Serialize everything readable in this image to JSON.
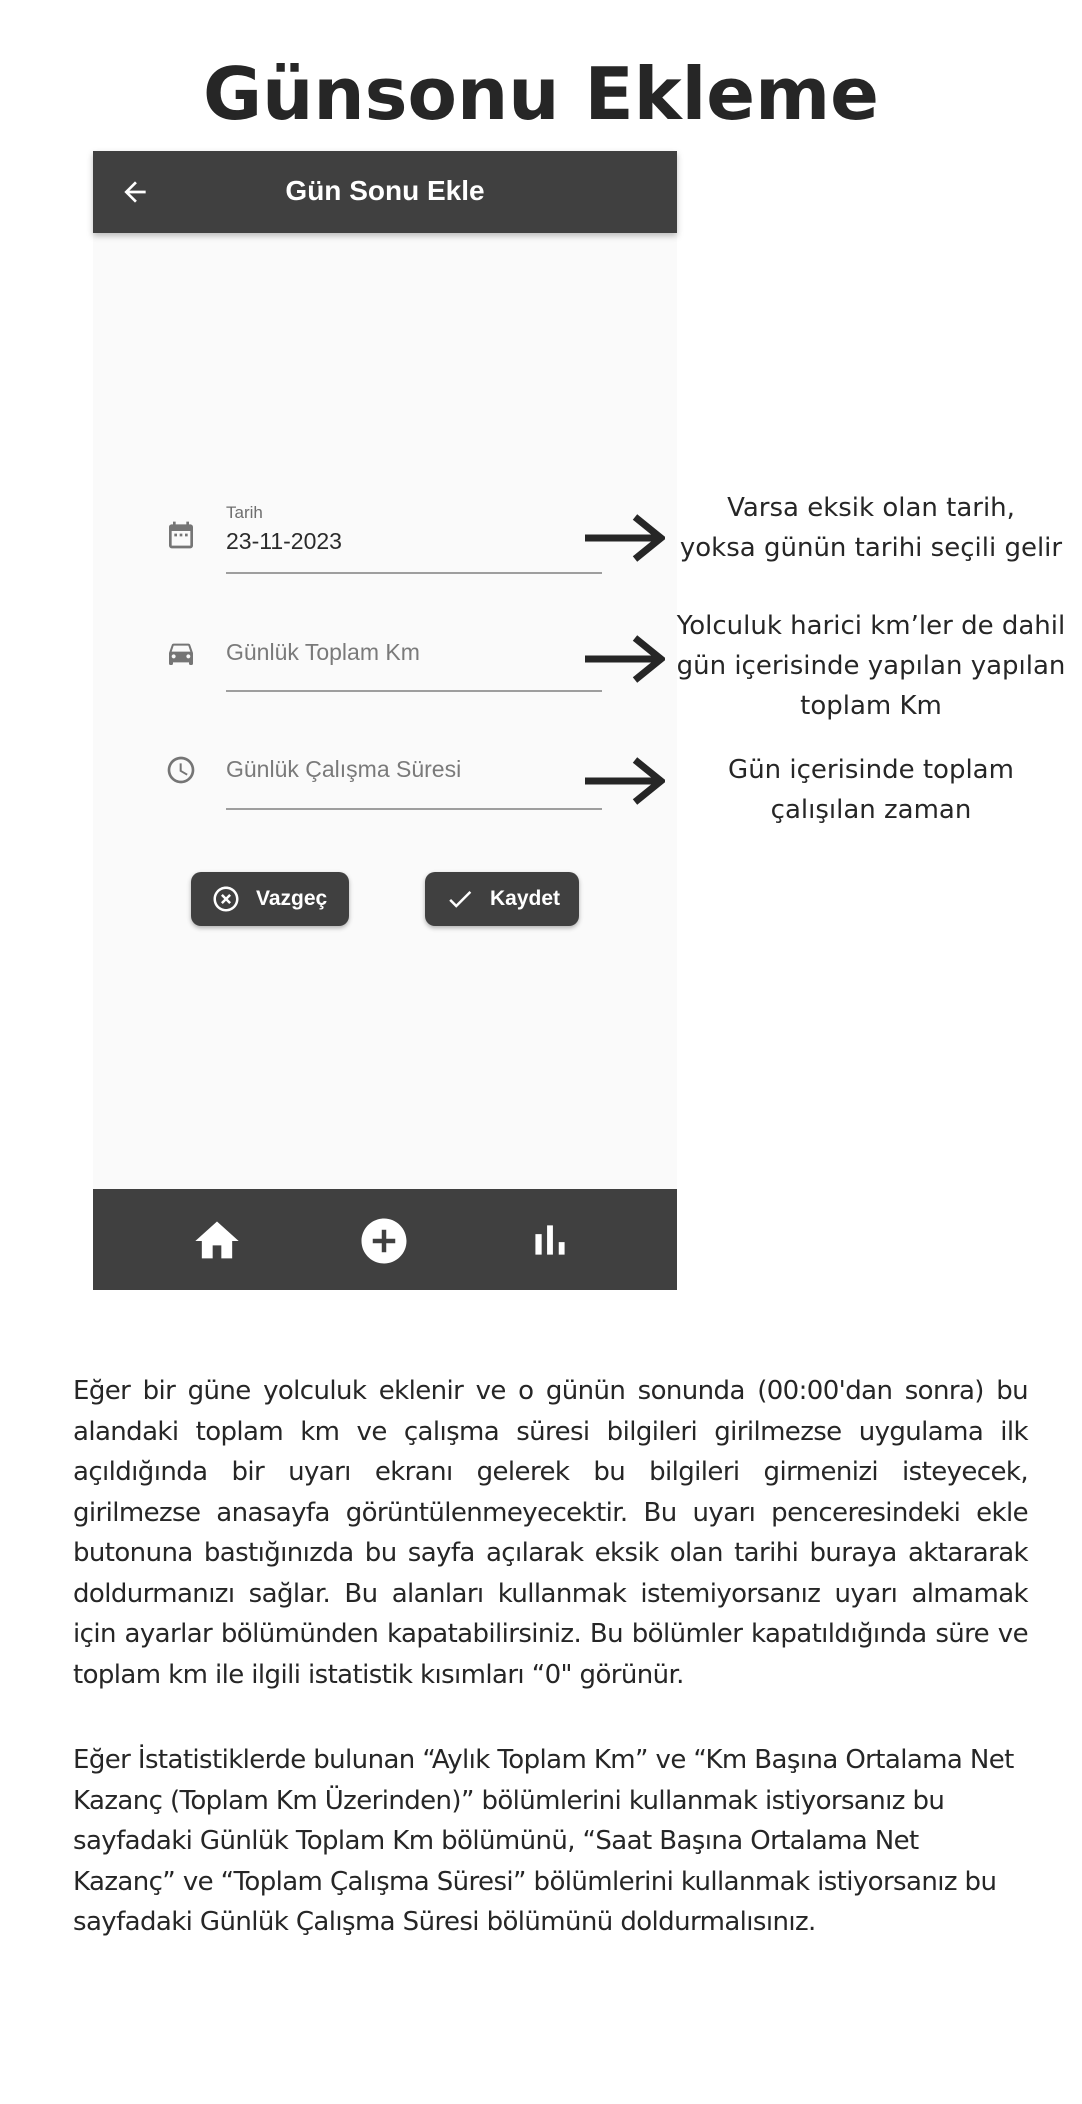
{
  "page": {
    "title": "Günsonu Ekleme"
  },
  "app": {
    "title": "Gün Sonu Ekle",
    "fields": {
      "date": {
        "label": "Tarih",
        "value": "23-11-2023",
        "icon": "calendar-icon"
      },
      "km": {
        "placeholder": "Günlük Toplam Km",
        "icon": "car-icon"
      },
      "duration": {
        "placeholder": "Günlük Çalışma Süresi",
        "icon": "clock-icon"
      }
    },
    "buttons": {
      "cancel": {
        "label": "Vazgeç",
        "icon": "cancel-circle-icon"
      },
      "save": {
        "label": "Kaydet",
        "icon": "check-icon"
      }
    },
    "nav": [
      "home-icon",
      "add-circle-icon",
      "bar-chart-icon"
    ],
    "colors": {
      "bar": "#404040",
      "background": "#fafafa"
    }
  },
  "annotations": {
    "date": "Varsa eksik olan tarih,\nyoksa günün tarihi seçili gelir",
    "km": "Yolculuk harici km’ler de dahil\ngün içerisinde yapılan yapılan\ntoplam Km",
    "duration": "Gün içerisinde toplam\nçalışılan zaman"
  },
  "paragraphs": [
    "Eğer bir güne yolculuk eklenir ve o günün sonunda (00:00'dan sonra) bu alandaki toplam km ve çalışma süresi bilgileri girilmezse uygulama ilk açıldığında bir uyarı ekranı gelerek bu bilgileri girmenizi isteyecek, girilmezse anasayfa görüntülenmeyecektir. Bu uyarı penceresindeki ekle butonuna bastığınızda bu sayfa açılarak eksik olan tarihi buraya aktararak doldurmanızı sağlar. Bu alanları kullanmak istemiyorsanız uyarı almamak için ayarlar bölümünden kapatabilirsiniz. Bu bölümler kapatıldığında süre ve toplam km ile ilgili istatistik kısımları “0\" görünür.",
    "Eğer İstatistiklerde bulunan “Aylık Toplam Km” ve “Km Başına Ortalama Net Kazanç (Toplam Km Üzerinden)” bölümlerini kullanmak istiyorsanız bu sayfadaki Günlük Toplam Km bölümünü, “Saat Başına Ortalama Net Kazanç” ve “Toplam Çalışma Süresi” bölümlerini kullanmak istiyorsanız bu sayfadaki Günlük Çalışma Süresi bölümünü doldurmalısınız."
  ]
}
